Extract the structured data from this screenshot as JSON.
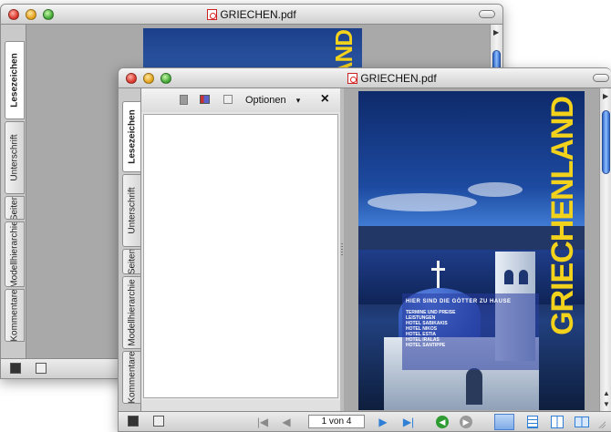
{
  "back_window": {
    "title": "GRIECHEN.pdf",
    "side_tabs": [
      {
        "label": "Lesezeichen",
        "active": true
      },
      {
        "label": "Unterschrift",
        "active": false
      },
      {
        "label": "Seiten",
        "active": false
      },
      {
        "label": "Modellhierarchie",
        "active": false
      },
      {
        "label": "Kommentare",
        "active": false
      }
    ],
    "cover_word": "GRIECHENLAND"
  },
  "front_window": {
    "title": "GRIECHEN.pdf",
    "side_tabs": [
      {
        "label": "Lesezeichen",
        "active": true
      },
      {
        "label": "Unterschrift",
        "active": false
      },
      {
        "label": "Seiten",
        "active": false
      },
      {
        "label": "Modellhierarchie",
        "active": false
      },
      {
        "label": "Kommentare",
        "active": false
      }
    ],
    "panel_toolbar": {
      "options_label": "Optionen",
      "options_arrow": "▾",
      "close_label": "×"
    },
    "page": {
      "cover_word": "GRIECHENLAND",
      "headline": "HIER SIND DIE GÖTTER ZU HAUSE",
      "list_items": [
        "TERMINE UND PREISE",
        "LEISTUNGEN",
        "HOTEL SABIKAKIS",
        "HOTEL NIKOS",
        "HOTEL ESTIA",
        "HOTEL IRALAS",
        "HOTEL SANTIPPE"
      ]
    },
    "navigation": {
      "page_field": "1 von 4",
      "first_icon": "first-page-icon",
      "prev_icon": "previous-page-icon",
      "next_icon": "next-page-icon",
      "last_icon": "last-page-icon",
      "back_icon": "go-back-icon",
      "forward_icon": "go-forward-icon"
    },
    "colors": {
      "accent_yellow": "#f3d21c",
      "nav_blue": "#2f7fd6",
      "nav_green": "#2e9b33"
    }
  }
}
